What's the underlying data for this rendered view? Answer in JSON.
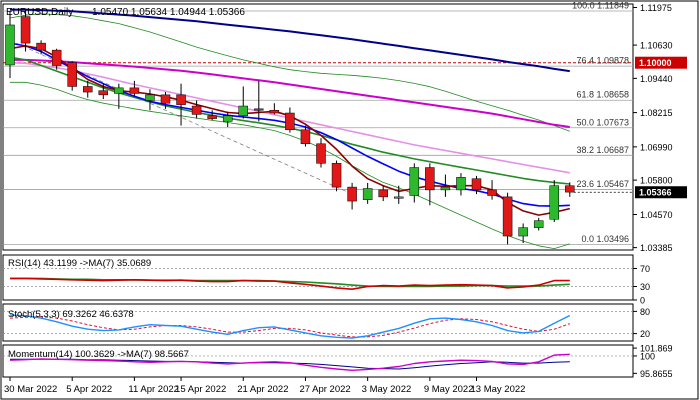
{
  "chart_data": {
    "type": "candlestick",
    "title": "EURUSD,Daily",
    "ohlc_label": "1.05470 1.05634 1.04944 1.05366",
    "price_axis": {
      "ylim": [
        1.033,
        1.121
      ],
      "ticks": [
        "1.11975",
        "1.10630",
        "1.09440",
        "1.08215",
        "1.06990",
        "1.05800",
        "1.04570",
        "1.03385"
      ]
    },
    "current_price": "1.05366",
    "level_1_label": "1.10000",
    "x_labels": [
      "30 Mar 2022",
      "5 Apr 2022",
      "11 Apr 2022",
      "15 Apr 2022",
      "21 Apr 2022",
      "27 Apr 2022",
      "3 May 2022",
      "9 May 2022",
      "13 May 2022"
    ],
    "x_label_index": [
      0,
      4,
      8,
      11,
      15,
      19,
      23,
      27,
      30
    ],
    "candles": [
      {
        "o": 1.0992,
        "h": 1.1185,
        "l": 1.0945,
        "c": 1.1135
      },
      {
        "o": 1.1165,
        "h": 1.1184,
        "l": 1.104,
        "c": 1.107
      },
      {
        "o": 1.107,
        "h": 1.108,
        "l": 1.103,
        "c": 1.1045
      },
      {
        "o": 1.1045,
        "h": 1.105,
        "l": 1.0975,
        "c": 1.099
      },
      {
        "o": 1.1,
        "h": 1.1005,
        "l": 1.09,
        "c": 1.0915
      },
      {
        "o": 1.0915,
        "h": 1.0935,
        "l": 1.0875,
        "c": 1.0895
      },
      {
        "o": 1.09,
        "h": 1.0925,
        "l": 1.087,
        "c": 1.0885
      },
      {
        "o": 1.089,
        "h": 1.0925,
        "l": 1.0835,
        "c": 1.091
      },
      {
        "o": 1.091,
        "h": 1.0935,
        "l": 1.088,
        "c": 1.089
      },
      {
        "o": 1.0865,
        "h": 1.0905,
        "l": 1.083,
        "c": 1.0885
      },
      {
        "o": 1.0885,
        "h": 1.0895,
        "l": 1.0835,
        "c": 1.0855
      },
      {
        "o": 1.0885,
        "h": 1.0925,
        "l": 1.0775,
        "c": 1.085
      },
      {
        "o": 1.0845,
        "h": 1.0865,
        "l": 1.08,
        "c": 1.0815
      },
      {
        "o": 1.081,
        "h": 1.083,
        "l": 1.0795,
        "c": 1.08
      },
      {
        "o": 1.079,
        "h": 1.0825,
        "l": 1.077,
        "c": 1.081
      },
      {
        "o": 1.081,
        "h": 1.0915,
        "l": 1.08,
        "c": 1.0845
      },
      {
        "o": 1.0835,
        "h": 1.0935,
        "l": 1.079,
        "c": 1.083
      },
      {
        "o": 1.083,
        "h": 1.0855,
        "l": 1.0815,
        "c": 1.082
      },
      {
        "o": 1.082,
        "h": 1.084,
        "l": 1.075,
        "c": 1.076
      },
      {
        "o": 1.076,
        "h": 1.0775,
        "l": 1.07,
        "c": 1.071
      },
      {
        "o": 1.071,
        "h": 1.073,
        "l": 1.0625,
        "c": 1.064
      },
      {
        "o": 1.064,
        "h": 1.065,
        "l": 1.054,
        "c": 1.0555
      },
      {
        "o": 1.0555,
        "h": 1.057,
        "l": 1.0475,
        "c": 1.0505
      },
      {
        "o": 1.051,
        "h": 1.057,
        "l": 1.0495,
        "c": 1.055
      },
      {
        "o": 1.0545,
        "h": 1.056,
        "l": 1.0505,
        "c": 1.052
      },
      {
        "o": 1.0515,
        "h": 1.056,
        "l": 1.0495,
        "c": 1.052
      },
      {
        "o": 1.0525,
        "h": 1.064,
        "l": 1.05,
        "c": 1.0625
      },
      {
        "o": 1.0625,
        "h": 1.064,
        "l": 1.049,
        "c": 1.0545
      },
      {
        "o": 1.0545,
        "h": 1.06,
        "l": 1.052,
        "c": 1.0555
      },
      {
        "o": 1.0545,
        "h": 1.0605,
        "l": 1.0525,
        "c": 1.059
      },
      {
        "o": 1.0585,
        "h": 1.0595,
        "l": 1.053,
        "c": 1.0545
      },
      {
        "o": 1.0545,
        "h": 1.058,
        "l": 1.051,
        "c": 1.0525
      },
      {
        "o": 1.052,
        "h": 1.0535,
        "l": 1.035,
        "c": 1.038
      },
      {
        "o": 1.038,
        "h": 1.0425,
        "l": 1.0355,
        "c": 1.041
      },
      {
        "o": 1.041,
        "h": 1.0445,
        "l": 1.04,
        "c": 1.0435
      },
      {
        "o": 1.044,
        "h": 1.058,
        "l": 1.043,
        "c": 1.056
      },
      {
        "o": 1.056,
        "h": 1.0572,
        "l": 1.052,
        "c": 1.0537
      }
    ],
    "moving_averages": [
      {
        "color": "#00008b",
        "values": [
          1.119,
          1.119,
          1.1188,
          1.1186,
          1.1184,
          1.118,
          1.1176,
          1.1172,
          1.1168,
          1.1163,
          1.1158,
          1.1153,
          1.1148,
          1.1142,
          1.1136,
          1.113,
          1.1124,
          1.1118,
          1.1112,
          1.1105,
          1.1098,
          1.1091,
          1.1084,
          1.1076,
          1.1068,
          1.106,
          1.1052,
          1.1044,
          1.1036,
          1.1028,
          1.102,
          1.1012,
          1.1003,
          1.0995,
          1.0987,
          1.0978,
          1.097
        ]
      },
      {
        "color": "#cc00cc",
        "values": [
          1.101,
          1.101,
          1.1008,
          1.1005,
          1.1002,
          1.0998,
          1.0994,
          1.099,
          1.0986,
          1.0981,
          1.0976,
          1.0971,
          1.0965,
          1.0958,
          1.0951,
          1.0944,
          1.0937,
          1.093,
          1.0922,
          1.0914,
          1.0906,
          1.0898,
          1.089,
          1.0882,
          1.0874,
          1.0866,
          1.0858,
          1.085,
          1.0842,
          1.0834,
          1.0826,
          1.0818,
          1.0808,
          1.0798,
          1.0788,
          1.0778,
          1.077
        ]
      },
      {
        "color": "#e58fe5",
        "values": [
          1.1,
          1.0998,
          1.099,
          1.0982,
          1.0972,
          1.096,
          1.0948,
          1.0935,
          1.0922,
          1.091,
          1.0898,
          1.0886,
          1.0874,
          1.0862,
          1.085,
          1.0838,
          1.0826,
          1.0814,
          1.0802,
          1.079,
          1.0778,
          1.0766,
          1.0754,
          1.0742,
          1.073,
          1.0718,
          1.0706,
          1.0696,
          1.0686,
          1.0676,
          1.0666,
          1.0656,
          1.0646,
          1.0636,
          1.0626,
          1.0616,
          1.0606
        ]
      },
      {
        "color": "#228b22",
        "values": [
          1.102,
          1.101,
          1.099,
          1.097,
          1.095,
          1.093,
          1.091,
          1.0892,
          1.0876,
          1.086,
          1.0846,
          1.0834,
          1.0822,
          1.0812,
          1.0802,
          1.0793,
          1.0785,
          1.0776,
          1.0766,
          1.0754,
          1.074,
          1.0724,
          1.0708,
          1.0694,
          1.068,
          1.0668,
          1.0656,
          1.0646,
          1.0636,
          1.0626,
          1.0616,
          1.0606,
          1.0596,
          1.0586,
          1.0578,
          1.0572,
          1.0566
        ]
      },
      {
        "color": "#0000ff",
        "values": [
          1.107,
          1.106,
          1.104,
          1.101,
          1.098,
          1.095,
          1.0925,
          1.09,
          1.088,
          1.0862,
          1.085,
          1.084,
          1.083,
          1.082,
          1.0812,
          1.0806,
          1.08,
          1.0794,
          1.0784,
          1.077,
          1.075,
          1.0725,
          1.0695,
          1.0665,
          1.0638,
          1.0612,
          1.0592,
          1.0576,
          1.0562,
          1.055,
          1.0542,
          1.053,
          1.0512,
          1.0496,
          1.0488,
          1.0487,
          1.049
        ]
      },
      {
        "color": "#8b0000",
        "values": [
          1.105,
          1.106,
          1.105,
          1.102,
          1.098,
          1.094,
          1.0915,
          1.09,
          1.0895,
          1.0888,
          1.0878,
          1.0866,
          1.085,
          1.0836,
          1.0822,
          1.0818,
          1.0822,
          1.0826,
          1.081,
          1.078,
          1.074,
          1.069,
          1.063,
          1.0585,
          1.056,
          1.054,
          1.055,
          1.056,
          1.0558,
          1.056,
          1.056,
          1.0545,
          1.05,
          1.047,
          1.0455,
          1.0465,
          1.0478
        ]
      }
    ],
    "bollinger": {
      "color": "#228b22",
      "upper": [
        1.116,
        1.117,
        1.1175,
        1.1172,
        1.1168,
        1.116,
        1.115,
        1.114,
        1.1125,
        1.111,
        1.1092,
        1.1074,
        1.1056,
        1.104,
        1.1025,
        1.101,
        1.0998,
        1.0985,
        1.0975,
        1.0968,
        1.0962,
        1.0958,
        1.0955,
        1.095,
        1.0944,
        1.0936,
        1.0926,
        1.0914,
        1.0898,
        1.088,
        1.0862,
        1.0846,
        1.083,
        1.0812,
        1.0795,
        1.0775,
        1.0755
      ],
      "lower": [
        1.093,
        1.093,
        1.092,
        1.0905,
        1.0885,
        1.0868,
        1.0855,
        1.0845,
        1.0835,
        1.0826,
        1.0818,
        1.081,
        1.0802,
        1.0794,
        1.0786,
        1.0778,
        1.0768,
        1.0757,
        1.074,
        1.072,
        1.0695,
        1.0665,
        1.0632,
        1.06,
        1.0572,
        1.0552,
        1.053,
        1.0505,
        1.048,
        1.0455,
        1.043,
        1.0405,
        1.0382,
        1.0362,
        1.0345,
        1.0335,
        1.0352
      ]
    },
    "trendline": {
      "from": [
        0,
        1.108
      ],
      "to": [
        22,
        1.053
      ],
      "color": "#808080"
    },
    "fibonacci": [
      {
        "label": "100.0 1.11849",
        "value": 1.11849
      },
      {
        "label": "76.4 1.09878",
        "value": 1.09878
      },
      {
        "label": "61.8 1.08658",
        "value": 1.08658
      },
      {
        "label": "50.0 1.07673",
        "value": 1.07673
      },
      {
        "label": "38.2 1.06687",
        "value": 1.06687
      },
      {
        "label": "23.6 1.05467",
        "value": 1.05467
      },
      {
        "label": "0.0 1.03496",
        "value": 1.03496
      }
    ],
    "rsi": {
      "label": "RSI(14) 43.1199 ->MA(7) 35.0689",
      "ylim": [
        0,
        100
      ],
      "ticks": [
        "70",
        "30",
        "0"
      ],
      "values": [
        48,
        48,
        47,
        46,
        45,
        44,
        43,
        44,
        45,
        44,
        43,
        44,
        42,
        41,
        41,
        43,
        42,
        42,
        38,
        35,
        31,
        27,
        24,
        30,
        32,
        31,
        33,
        32,
        33,
        34,
        33,
        32,
        27,
        29,
        33,
        43,
        43
      ],
      "ma": [
        48,
        48,
        48,
        47,
        46,
        46,
        45,
        45,
        45,
        44,
        44,
        44,
        43,
        43,
        43,
        43,
        43,
        42,
        41,
        40,
        38,
        36,
        33,
        31,
        30,
        30,
        30,
        30,
        31,
        31,
        32,
        32,
        31,
        31,
        31,
        33,
        35
      ]
    },
    "stoch": {
      "label": "Stoch(5,3,3) 69.3262 46.6378",
      "ylim": [
        0,
        100
      ],
      "ticks": [
        "80",
        "20"
      ],
      "k": [
        70,
        68,
        62,
        52,
        40,
        32,
        28,
        30,
        38,
        44,
        42,
        40,
        32,
        24,
        18,
        28,
        36,
        38,
        30,
        22,
        14,
        10,
        8,
        14,
        24,
        34,
        48,
        60,
        62,
        58,
        52,
        42,
        28,
        22,
        26,
        48,
        69
      ],
      "d": [
        62,
        64,
        66,
        62,
        54,
        44,
        36,
        30,
        32,
        38,
        42,
        42,
        38,
        32,
        24,
        24,
        28,
        34,
        34,
        30,
        22,
        16,
        11,
        11,
        15,
        24,
        35,
        47,
        56,
        60,
        58,
        52,
        42,
        32,
        26,
        32,
        47
      ]
    },
    "momentum": {
      "label": "Momentum(14) 100.3629 ->MA(7) 98.5667",
      "ylim": [
        95.0,
        102.6
      ],
      "ticks": [
        "101.869",
        "100",
        "95.8655"
      ],
      "values": [
        99.0,
        99.1,
        99.3,
        99.2,
        99.1,
        99.0,
        98.9,
        98.8,
        98.6,
        98.5,
        98.6,
        98.7,
        98.6,
        98.3,
        98.1,
        98.3,
        98.5,
        98.6,
        98.4,
        97.8,
        97.3,
        96.9,
        96.6,
        96.8,
        97.1,
        97.5,
        98.2,
        98.6,
        98.8,
        99.0,
        98.9,
        98.7,
        98.1,
        98.0,
        98.6,
        100.2,
        100.4
      ],
      "ma": [
        99.2,
        99.2,
        99.2,
        99.2,
        99.2,
        99.1,
        99.1,
        99.0,
        98.9,
        98.8,
        98.7,
        98.7,
        98.6,
        98.5,
        98.4,
        98.3,
        98.4,
        98.4,
        98.3,
        98.2,
        98.0,
        97.7,
        97.4,
        97.1,
        97.0,
        96.9,
        97.2,
        97.6,
        97.9,
        98.2,
        98.4,
        98.6,
        98.5,
        98.3,
        98.3,
        98.5,
        98.6
      ]
    },
    "colors": {
      "bull": "#2eb82e",
      "bear": "#e01818",
      "border": "#000000",
      "grid": "#c8c8c8",
      "rsi_line": "#cc0000",
      "rsi_ma": "#228b22",
      "stoch_k": "#1e90ff",
      "stoch_d": "#dc143c",
      "mom_line": "#cc00cc",
      "mom_ma": "#00008b",
      "level_red": "#cc0000"
    }
  }
}
